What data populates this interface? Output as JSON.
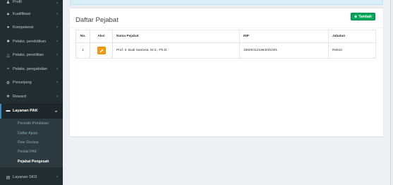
{
  "sidebar": {
    "items": [
      {
        "label": "Profil",
        "icon": "user-icon"
      },
      {
        "label": "Kualifikasi",
        "icon": "graduation-cap-icon"
      },
      {
        "label": "Kompetensi",
        "icon": "users-icon"
      },
      {
        "label": "Pelaks. pendidikan",
        "icon": "book-icon"
      },
      {
        "label": "Pelaks. penelitian",
        "icon": "flask-icon"
      },
      {
        "label": "Pelaks. pengabdian",
        "icon": "hands-icon"
      },
      {
        "label": "Penunjang",
        "icon": "gear-icon"
      },
      {
        "label": "Reward",
        "icon": "trophy-icon"
      },
      {
        "label": "Layanan PAK",
        "icon": "folder-icon"
      }
    ],
    "submenu": [
      "Periode Penilaian",
      "Daftar Ajuan",
      "Peer Review",
      "Penilai PAK",
      "Pejabat Pengesah"
    ],
    "bottom_item": {
      "label": "Layanan SKD",
      "icon": "list-icon"
    }
  },
  "main": {
    "title": "Daftar Pejabat",
    "add_button": "Tambah",
    "table": {
      "columns": [
        "No.",
        "Aksi",
        "Nama Pejabat",
        "NIP",
        "Jabatan"
      ],
      "rows": [
        {
          "no": "1",
          "nama": "Prof. Ir. Budi Santosa, M.S., Ph.D.",
          "nip": "196004121984031001",
          "jabatan": "Rektor"
        }
      ]
    }
  },
  "colors": {
    "sidebar_bg": "#222d32",
    "submenu_bg": "#2c3b41",
    "accent": "#3c8dbc",
    "add_button": "#00a65a",
    "edit_button": "#f39c12"
  }
}
